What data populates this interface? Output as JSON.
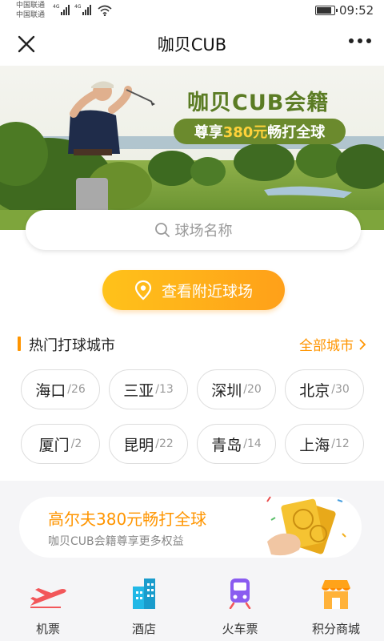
{
  "status_bar": {
    "carrier_1": "中国联通",
    "carrier_2": "中国联通",
    "network_1": "4G",
    "network_2": "4G",
    "time": "09:52",
    "battery_level": 0.85
  },
  "title_bar": {
    "title": "咖贝CUB",
    "close_icon": "close-icon",
    "more_icon": "more-icon"
  },
  "banner": {
    "title": "咖贝CUB会籍",
    "subtitle_prefix": "尊享",
    "subtitle_highlight": "380元",
    "subtitle_suffix": "畅打全球",
    "title_color": "#5b7c24",
    "pill_color": "#6b8a2d",
    "highlight_color": "#ffd23a"
  },
  "search": {
    "placeholder": "球场名称",
    "icon": "search-icon"
  },
  "nearby": {
    "label": "查看附近球场",
    "icon": "location-pin-icon"
  },
  "hot_cities": {
    "title": "热门打球城市",
    "all_label": "全部城市",
    "accent": "#ff9500",
    "items": [
      {
        "name": "海口",
        "count": "/26"
      },
      {
        "name": "三亚",
        "count": "/13"
      },
      {
        "name": "深圳",
        "count": "/20"
      },
      {
        "name": "北京",
        "count": "/30"
      },
      {
        "name": "厦门",
        "count": "/2"
      },
      {
        "name": "昆明",
        "count": "/22"
      },
      {
        "name": "青岛",
        "count": "/14"
      },
      {
        "name": "上海",
        "count": "/12"
      }
    ]
  },
  "promo": {
    "title": "高尔夫380元畅打全球",
    "subtitle": "咖贝CUB会籍尊享更多权益"
  },
  "bottom_nav": {
    "items": [
      {
        "label": "机票",
        "icon": "airplane-icon"
      },
      {
        "label": "酒店",
        "icon": "hotel-icon"
      },
      {
        "label": "火车票",
        "icon": "train-icon"
      },
      {
        "label": "积分商城",
        "icon": "shop-icon"
      }
    ]
  }
}
